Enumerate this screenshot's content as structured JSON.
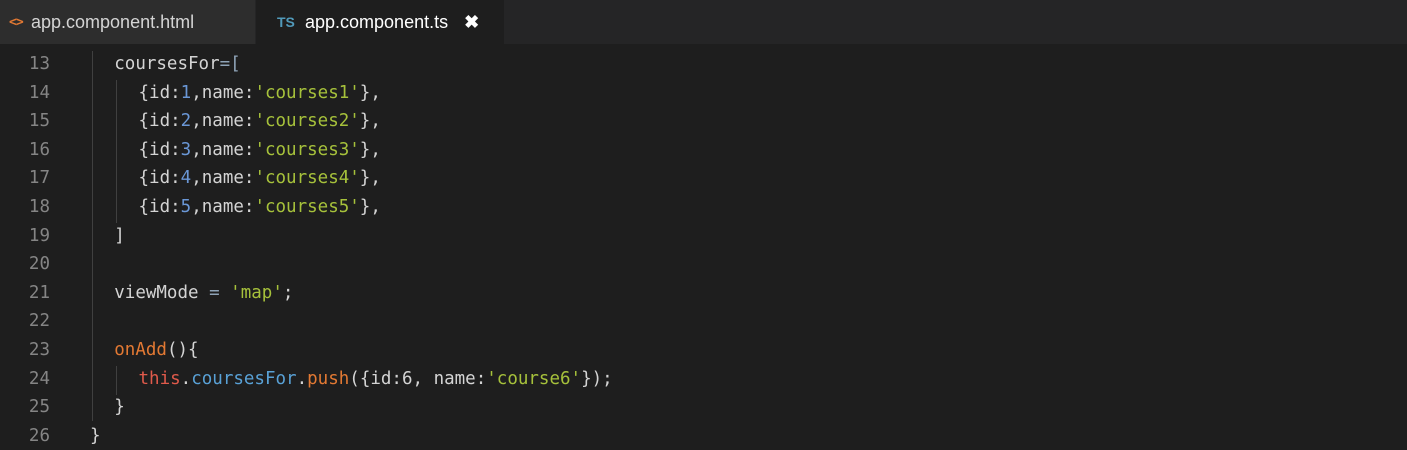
{
  "tabs": [
    {
      "label": "app.component.html",
      "icon": "<>",
      "icon_name": "html-file-icon",
      "active": false
    },
    {
      "label": "app.component.ts",
      "icon": "TS",
      "icon_name": "typescript-file-icon",
      "active": true,
      "close": "✖"
    }
  ],
  "colors": {
    "background": "#1e1e1e",
    "tabbar": "#252526",
    "inactive_tab": "#2d2d2d",
    "line_number": "#858585",
    "string": "#a6c13b",
    "number": "#6a97d6",
    "function": "#e37933",
    "keyword": "#e05a4b",
    "property": "#59a1d6"
  },
  "lines": [
    {
      "n": "13",
      "tokens": [
        [
          "id",
          "coursesFor"
        ],
        [
          "op",
          "=["
        ]
      ]
    },
    {
      "n": "14",
      "tokens": [
        [
          "id",
          "{id:"
        ],
        [
          "num",
          "1"
        ],
        [
          "id",
          ",name:"
        ],
        [
          "str",
          "'courses1'"
        ],
        [
          "id",
          "},"
        ]
      ]
    },
    {
      "n": "15",
      "tokens": [
        [
          "id",
          "{id:"
        ],
        [
          "num",
          "2"
        ],
        [
          "id",
          ",name:"
        ],
        [
          "str",
          "'courses2'"
        ],
        [
          "id",
          "},"
        ]
      ]
    },
    {
      "n": "16",
      "tokens": [
        [
          "id",
          "{id:"
        ],
        [
          "num",
          "3"
        ],
        [
          "id",
          ",name:"
        ],
        [
          "str",
          "'courses3'"
        ],
        [
          "id",
          "},"
        ]
      ]
    },
    {
      "n": "17",
      "tokens": [
        [
          "id",
          "{id:"
        ],
        [
          "num",
          "4"
        ],
        [
          "id",
          ",name:"
        ],
        [
          "str",
          "'courses4'"
        ],
        [
          "id",
          "},"
        ]
      ]
    },
    {
      "n": "18",
      "tokens": [
        [
          "id",
          "{id:"
        ],
        [
          "num",
          "5"
        ],
        [
          "id",
          ",name:"
        ],
        [
          "str",
          "'courses5'"
        ],
        [
          "id",
          "},"
        ]
      ]
    },
    {
      "n": "19",
      "tokens": [
        [
          "id",
          "]"
        ]
      ]
    },
    {
      "n": "20",
      "tokens": []
    },
    {
      "n": "21",
      "tokens": [
        [
          "id",
          "viewMode "
        ],
        [
          "op",
          "="
        ],
        [
          "id",
          " "
        ],
        [
          "str",
          "'map'"
        ],
        [
          "id",
          ";"
        ]
      ]
    },
    {
      "n": "22",
      "tokens": []
    },
    {
      "n": "23",
      "tokens": [
        [
          "fn",
          "onAdd"
        ],
        [
          "id",
          "(){"
        ]
      ]
    },
    {
      "n": "24",
      "tokens": [
        [
          "kw",
          "this"
        ],
        [
          "id",
          "."
        ],
        [
          "prop",
          "coursesFor"
        ],
        [
          "id",
          "."
        ],
        [
          "fn",
          "push"
        ],
        [
          "id",
          "({id:6, name:"
        ],
        [
          "str",
          "'course6'"
        ],
        [
          "id",
          "});"
        ]
      ]
    },
    {
      "n": "25",
      "tokens": [
        [
          "id",
          "}"
        ]
      ]
    },
    {
      "n": "26",
      "tokens": [
        [
          "id",
          "}"
        ]
      ]
    }
  ]
}
